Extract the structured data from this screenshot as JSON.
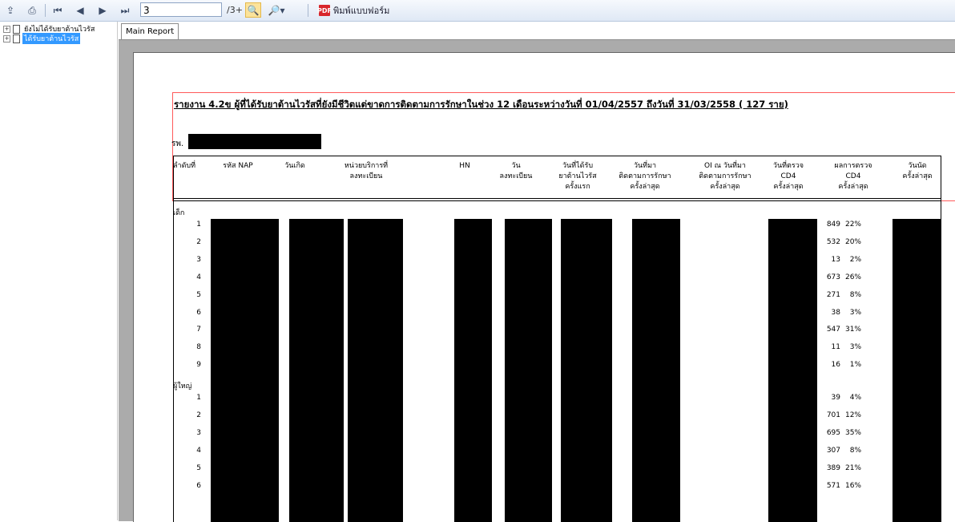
{
  "toolbar": {
    "page_value": "3",
    "page_total": "/3+",
    "print_form_label": "พิมพ์แบบฟอร์ม"
  },
  "tree": {
    "items": [
      {
        "label": "ยังไม่ได้รับยาต้านไวรัส",
        "selected": false
      },
      {
        "label": "ได้รับยาต้านไวรัส",
        "selected": true
      }
    ]
  },
  "tabs": [
    {
      "label": "Main Report"
    }
  ],
  "report": {
    "title": "รายงาน 4.2ข   ผู้ที่ได้รับยาต้านไวรัสที่ยังมีชีวิตแต่ขาดการติดตามการรักษาในช่วง 12 เดือนระหว่างวันที่ 01/04/2557 ถึงวันที่ 31/03/2558 ( 127 ราย)",
    "hospital_label": "รพ.",
    "columns": [
      "ลำดับที่",
      "รหัส NAP",
      "วันเกิด",
      "หน่วยบริการที่\nลงทะเบียน",
      "HN",
      "วัน\nลงทะเบียน",
      "วันที่ได้รับ\nยาต้านไวรัส\nครั้งแรก",
      "วันที่มา\nติดตามการรักษา\nครั้งล่าสุด",
      "OI ณ วันที่มา\nติดตามการรักษา\nครั้งล่าสุด",
      "วันที่ตรวจ\nCD4\nครั้งล่าสุด",
      "ผลการตรวจ\nCD4\nครั้งล่าสุด",
      "วันนัด\nครั้งล่าสุด"
    ],
    "groups": [
      {
        "label": "เด็ก",
        "rows": [
          {
            "no": "1",
            "cd4": "849",
            "pct": "22%"
          },
          {
            "no": "2",
            "cd4": "532",
            "pct": "20%"
          },
          {
            "no": "3",
            "cd4": "13",
            "pct": "2%"
          },
          {
            "no": "4",
            "cd4": "673",
            "pct": "26%"
          },
          {
            "no": "5",
            "cd4": "271",
            "pct": "8%"
          },
          {
            "no": "6",
            "cd4": "38",
            "pct": "3%"
          },
          {
            "no": "7",
            "cd4": "547",
            "pct": "31%"
          },
          {
            "no": "8",
            "cd4": "11",
            "pct": "3%"
          },
          {
            "no": "9",
            "cd4": "16",
            "pct": "1%"
          }
        ]
      },
      {
        "label": "ผู้ใหญ่",
        "rows": [
          {
            "no": "1",
            "cd4": "39",
            "pct": "4%"
          },
          {
            "no": "2",
            "cd4": "701",
            "pct": "12%"
          },
          {
            "no": "3",
            "cd4": "695",
            "pct": "35%"
          },
          {
            "no": "4",
            "cd4": "307",
            "pct": "8%"
          },
          {
            "no": "5",
            "cd4": "389",
            "pct": "21%"
          },
          {
            "no": "6",
            "cd4": "571",
            "pct": "16%"
          }
        ]
      }
    ]
  }
}
